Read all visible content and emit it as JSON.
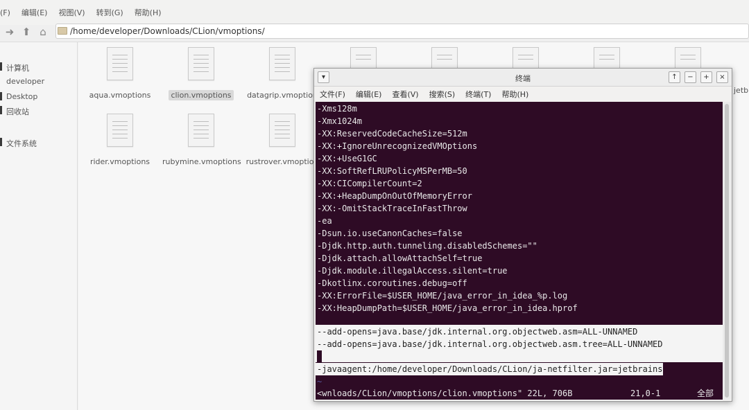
{
  "file_manager": {
    "menu": [
      "(F)",
      "编辑(E)",
      "视图(V)",
      "转到(G)",
      "帮助(H)"
    ],
    "location": "/home/developer/Downloads/CLion/vmoptions/",
    "sidebar": [
      "计算机",
      "developer",
      "Desktop",
      "回收站",
      "文件系统"
    ],
    "files": [
      {
        "name": "aqua.vmoptions"
      },
      {
        "name": "clion.vmoptions"
      },
      {
        "name": "datagrip.vmoption"
      },
      {
        "name": "rider.vmoptions"
      },
      {
        "name": "rubymine.vmoptions"
      },
      {
        "name": "rustrover.vmoption"
      }
    ],
    "partial_file_label": "jetb"
  },
  "terminal": {
    "title": "终端",
    "window_buttons": [
      "↑",
      "−",
      "+",
      "×"
    ],
    "menu": [
      "文件(F)",
      "编辑(E)",
      "查看(V)",
      "搜索(S)",
      "终端(T)",
      "帮助(H)"
    ],
    "lines": [
      "-Xms128m",
      "-Xmx1024m",
      "-XX:ReservedCodeCacheSize=512m",
      "-XX:+IgnoreUnrecognizedVMOptions",
      "-XX:+UseG1GC",
      "-XX:SoftRefLRUPolicyMSPerMB=50",
      "-XX:CICompilerCount=2",
      "-XX:+HeapDumpOnOutOfMemoryError",
      "-XX:-OmitStackTraceInFastThrow",
      "-ea",
      "-Dsun.io.useCanonCaches=false",
      "-Djdk.http.auth.tunneling.disabledSchemes=\"\"",
      "-Djdk.attach.allowAttachSelf=true",
      "-Djdk.module.illegalAccess.silent=true",
      "-Dkotlinx.coroutines.debug=off",
      "-XX:ErrorFile=$USER_HOME/java_error_in_idea_%p.log",
      "-XX:HeapDumpPath=$USER_HOME/java_error_in_idea.hprof"
    ],
    "highlighted_lines": [
      "--add-opens=java.base/jdk.internal.org.objectweb.asm=ALL-UNNAMED",
      "--add-opens=java.base/jdk.internal.org.objectweb.asm.tree=ALL-UNNAMED"
    ],
    "javaagent_line": "-javaagent:/home/developer/Downloads/CLion/ja-netfilter.jar=jetbrains",
    "tilde": "~",
    "status_file": "<wnloads/CLion/vmoptions/clion.vmoptions\" 22L, 706B",
    "status_pos": "21,0-1",
    "status_scope": "全部"
  }
}
